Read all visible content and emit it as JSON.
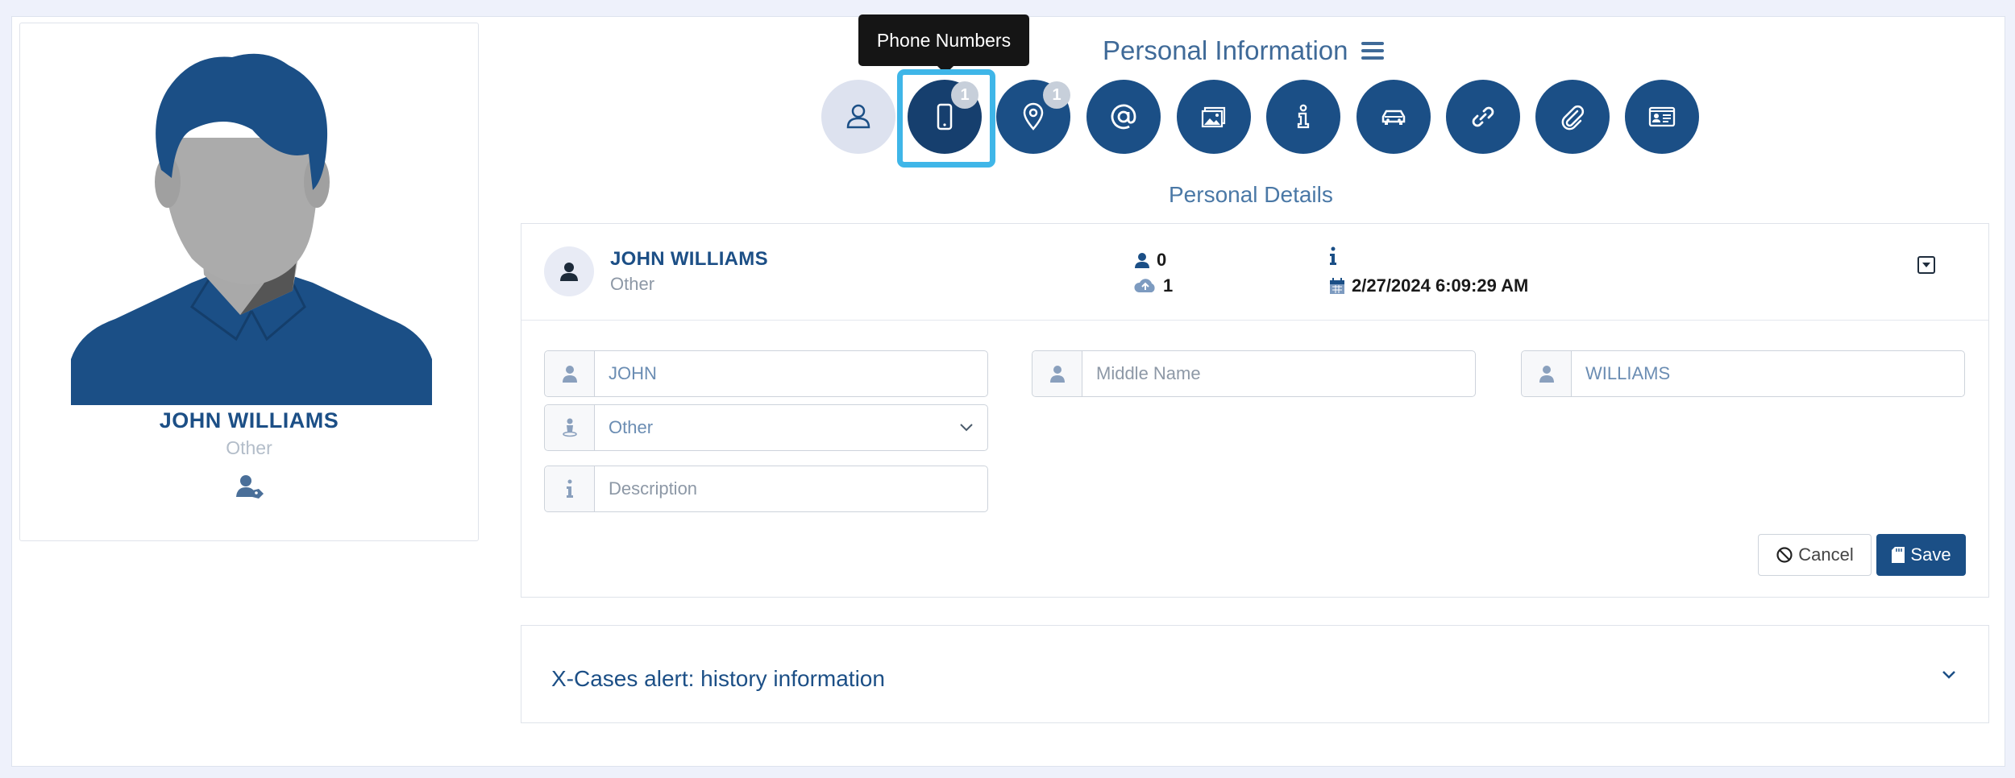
{
  "profile": {
    "name": "JOHN WILLIAMS",
    "type": "Other"
  },
  "tooltip": "Phone Numbers",
  "section_title": "Personal Information",
  "icon_tabs": [
    {
      "name": "person",
      "icon": "user-icon",
      "badge": ""
    },
    {
      "name": "phone",
      "icon": "phone-icon",
      "badge": "1"
    },
    {
      "name": "address",
      "icon": "map-pin-icon",
      "badge": "1"
    },
    {
      "name": "email",
      "icon": "at-icon",
      "badge": ""
    },
    {
      "name": "images",
      "icon": "image-icon",
      "badge": ""
    },
    {
      "name": "info",
      "icon": "info-icon",
      "badge": ""
    },
    {
      "name": "vehicles",
      "icon": "car-icon",
      "badge": ""
    },
    {
      "name": "links",
      "icon": "link-icon",
      "badge": ""
    },
    {
      "name": "attachments",
      "icon": "paperclip-icon",
      "badge": ""
    },
    {
      "name": "id-card",
      "icon": "id-card-icon",
      "badge": ""
    }
  ],
  "subsection_title": "Personal Details",
  "details_header": {
    "name": "JOHN WILLIAMS",
    "type": "Other",
    "users_count": "0",
    "uploads_count": "1",
    "datetime": "2/27/2024 6:09:29 AM"
  },
  "form": {
    "first_name": "JOHN",
    "middle_name_placeholder": "Middle Name",
    "last_name": "WILLIAMS",
    "type_selected": "Other",
    "description_placeholder": "Description"
  },
  "buttons": {
    "cancel": "Cancel",
    "save": "Save"
  },
  "alert_panel": {
    "title": "X-Cases alert: history information"
  },
  "colors": {
    "primary": "#1b4f86",
    "active_ring": "#3fb6e8",
    "inactive_icon": "#dde2ef",
    "badge": "#c7cfda"
  }
}
